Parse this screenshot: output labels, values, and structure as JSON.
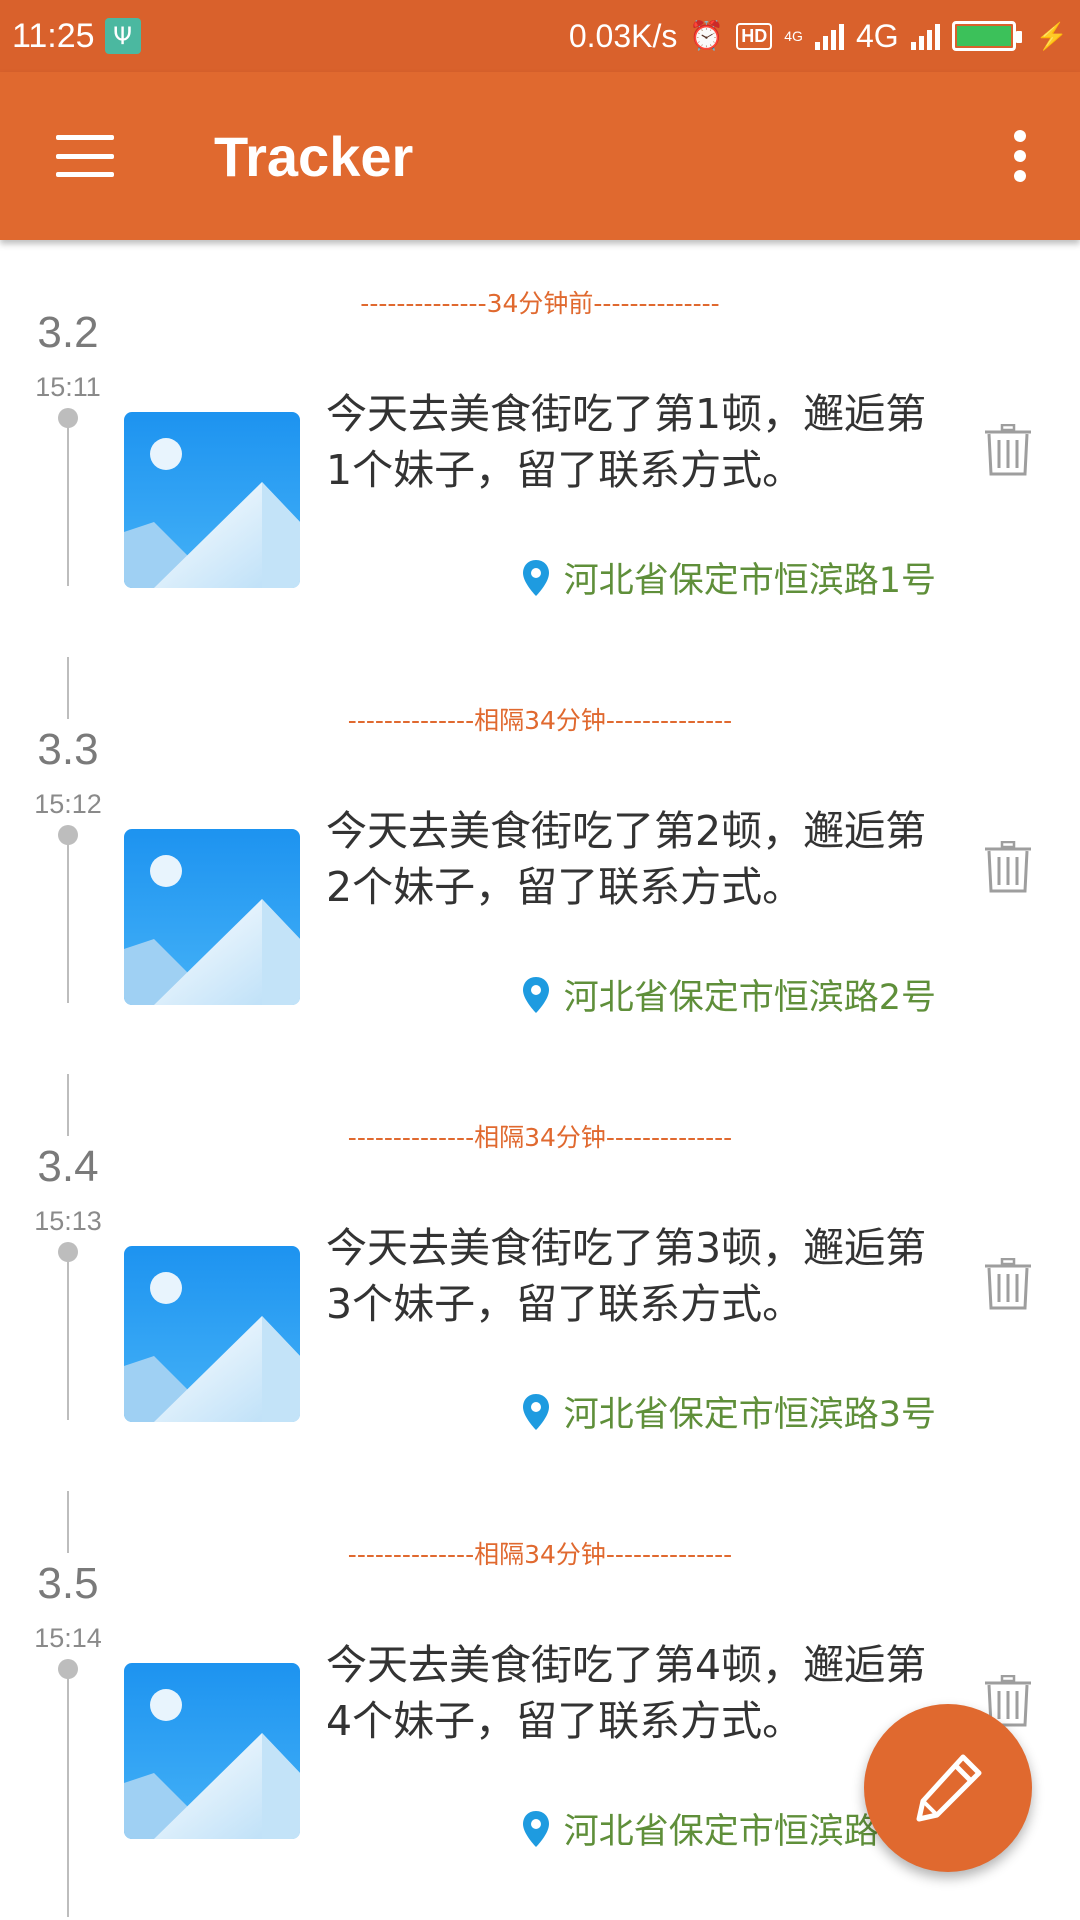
{
  "status_bar": {
    "time": "11:25",
    "net_speed": "0.03K/s",
    "network_type": "4G",
    "hd_label": "HD",
    "small_4g_label": "4G",
    "battery_level": 1.0
  },
  "app_bar": {
    "title": "Tracker"
  },
  "entries": [
    {
      "divider": "--------------34分钟前--------------",
      "date": "3.2",
      "time": "15:11",
      "text": "今天去美食街吃了第1顿，邂逅第1个妹子，留了联系方式。",
      "location": "河北省保定市恒滨路1号"
    },
    {
      "divider": "--------------相隔34分钟--------------",
      "date": "3.3",
      "time": "15:12",
      "text": "今天去美食街吃了第2顿，邂逅第2个妹子，留了联系方式。",
      "location": "河北省保定市恒滨路2号"
    },
    {
      "divider": "--------------相隔34分钟--------------",
      "date": "3.4",
      "time": "15:13",
      "text": "今天去美食街吃了第3顿，邂逅第3个妹子，留了联系方式。",
      "location": "河北省保定市恒滨路3号"
    },
    {
      "divider": "--------------相隔34分钟--------------",
      "date": "3.5",
      "time": "15:14",
      "text": "今天去美食街吃了第4顿，邂逅第4个妹子，留了联系方式。",
      "location": "河北省保定市恒滨路4号"
    }
  ],
  "colors": {
    "status_bar": "#d9612c",
    "app_bar": "#e0692f",
    "accent": "#e0692f",
    "location_text": "#5f8f3a",
    "pin": "#1e9be0"
  },
  "icons": {
    "menu": "menu-icon",
    "more": "more-vert-icon",
    "delete": "trash-icon",
    "location": "location-pin-icon",
    "fab": "pencil-icon",
    "image": "image-placeholder-icon"
  }
}
